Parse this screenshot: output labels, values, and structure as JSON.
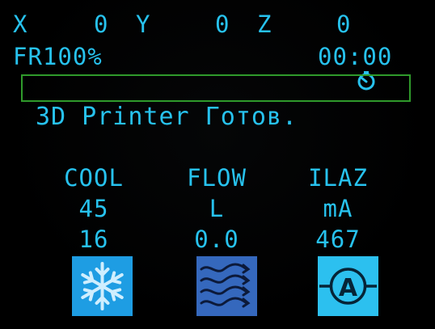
{
  "status": {
    "x_label": "X",
    "x_value": "0",
    "y_label": "Y",
    "y_value": "0",
    "z_label": "Z",
    "z_value": "0",
    "feedrate": "FR100%",
    "clock_icon": "stopwatch-icon",
    "elapsed": "00:00"
  },
  "progress": {
    "value": 0,
    "color": "#2f9a2b"
  },
  "message": "3D Printer Готов.",
  "panels": [
    {
      "title": "COOL",
      "line1": "45",
      "line2": "16",
      "icon": "snowflake-icon",
      "icon_bg": "#1e9de3"
    },
    {
      "title": "FLOW",
      "line1": "L",
      "line2": "0.0",
      "icon": "waves-icon",
      "icon_bg": "#3568bd"
    },
    {
      "title": "ILAZ",
      "line1": "mA",
      "line2": "467",
      "icon": "ammeter-icon",
      "icon_bg": "#2cc0ef"
    }
  ],
  "colors": {
    "text": "#27c2ee",
    "background": "#000000"
  }
}
